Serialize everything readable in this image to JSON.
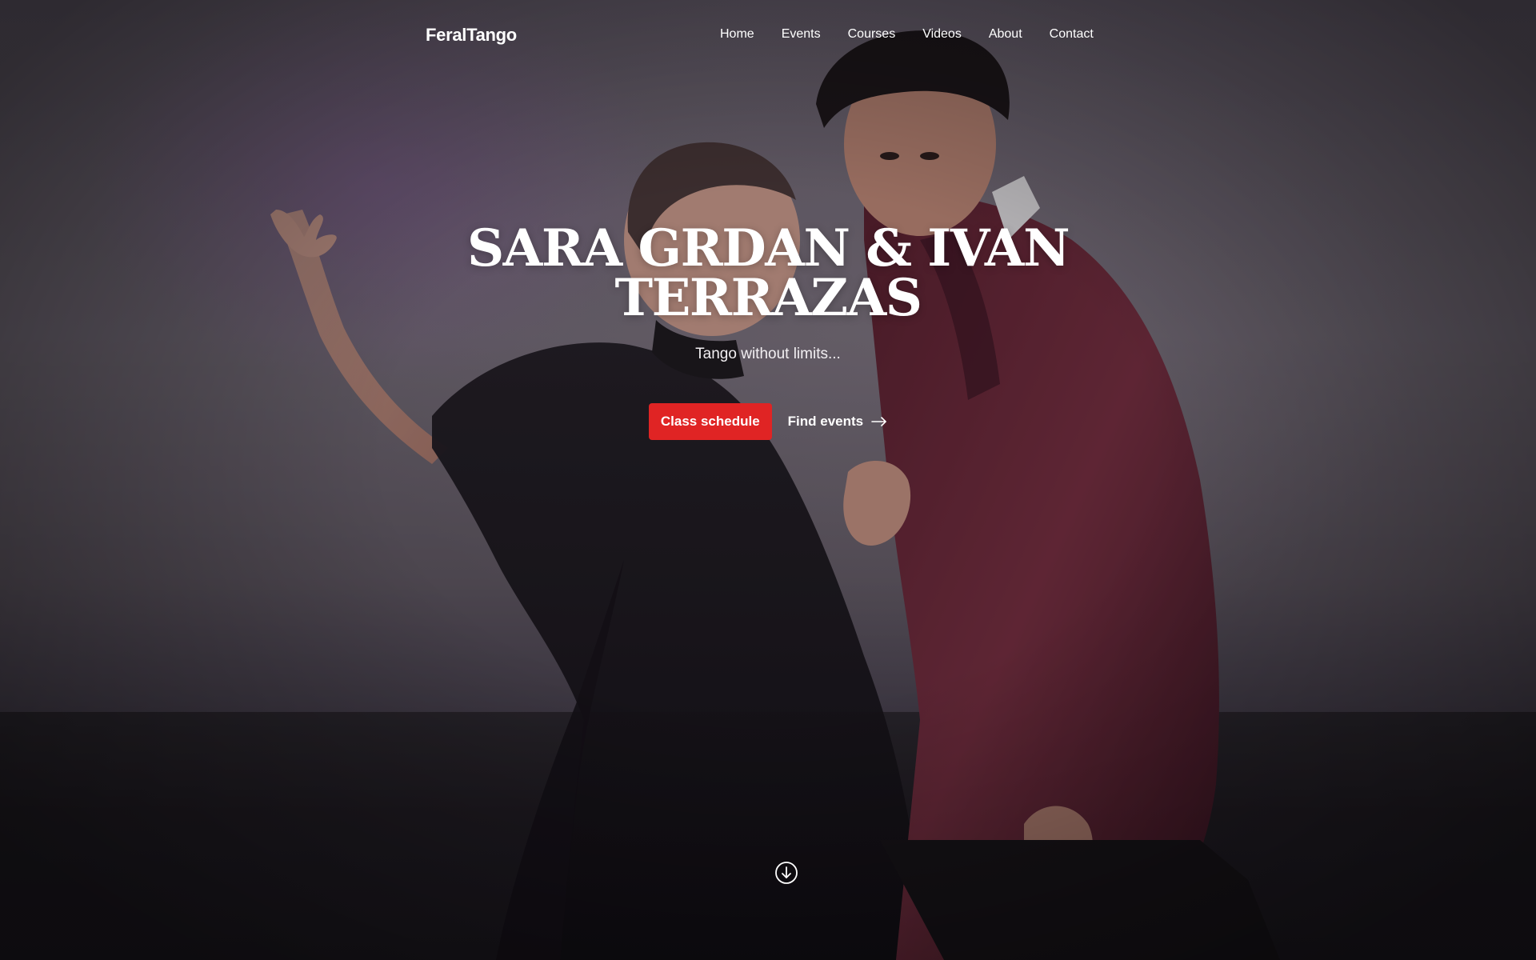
{
  "nav": {
    "brand": "FeralTango",
    "links": [
      {
        "label": "Home"
      },
      {
        "label": "Events"
      },
      {
        "label": "Courses"
      },
      {
        "label": "Videos"
      },
      {
        "label": "About"
      },
      {
        "label": "Contact"
      }
    ]
  },
  "hero": {
    "title_line1": "SARA GRDAN & IVAN",
    "title_line2": "TERRAZAS",
    "subtitle": "Tango without limits...",
    "primary_button": "Class schedule",
    "secondary_link": "Find events",
    "background_image": "tango-dancers-photo",
    "scroll_icon": "arrow-down-circle-icon"
  },
  "colors": {
    "accent": "#e02424",
    "text": "#ffffff",
    "overlay": "#14101a"
  }
}
